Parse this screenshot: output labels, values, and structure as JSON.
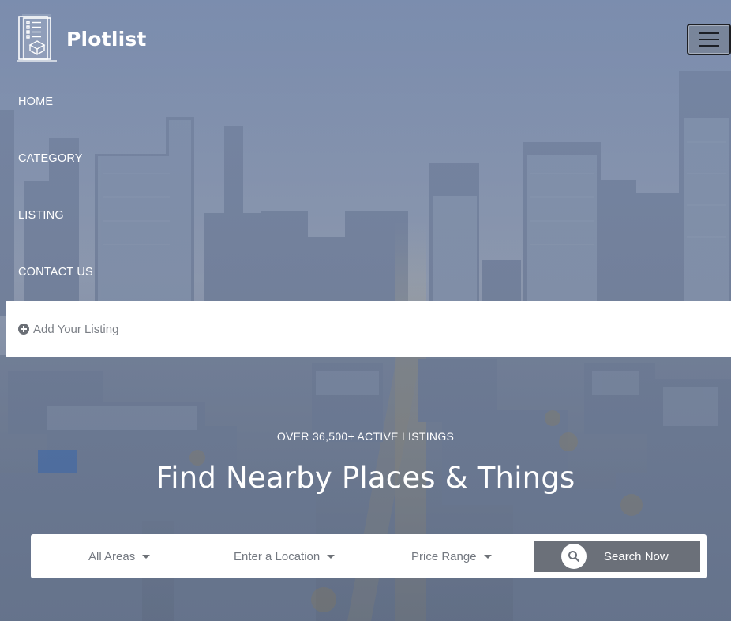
{
  "brand": {
    "name": "Plotlist"
  },
  "nav": {
    "items": [
      {
        "label": "HOME"
      },
      {
        "label": "CATEGORY"
      },
      {
        "label": "LISTING"
      },
      {
        "label": "CONTACT US"
      }
    ],
    "add_listing_label": "Add Your Listing"
  },
  "hero": {
    "subtitle": "OVER 36,500+ ACTIVE LISTINGS",
    "title": "Find Nearby Places & Things"
  },
  "search": {
    "areas_label": "All Areas",
    "location_label": "Enter a Location",
    "price_label": "Price Range",
    "button_label": "Search Now"
  },
  "icons": {
    "logo": "clipboard-list-icon",
    "menu": "hamburger-menu-icon",
    "add": "plus-circle-icon",
    "search": "search-icon",
    "dropdown": "caret-down-icon"
  },
  "colors": {
    "overlay": "#6f80a0",
    "search_button": "#6b7079",
    "text_light": "#ffffff",
    "text_muted": "#737880"
  }
}
